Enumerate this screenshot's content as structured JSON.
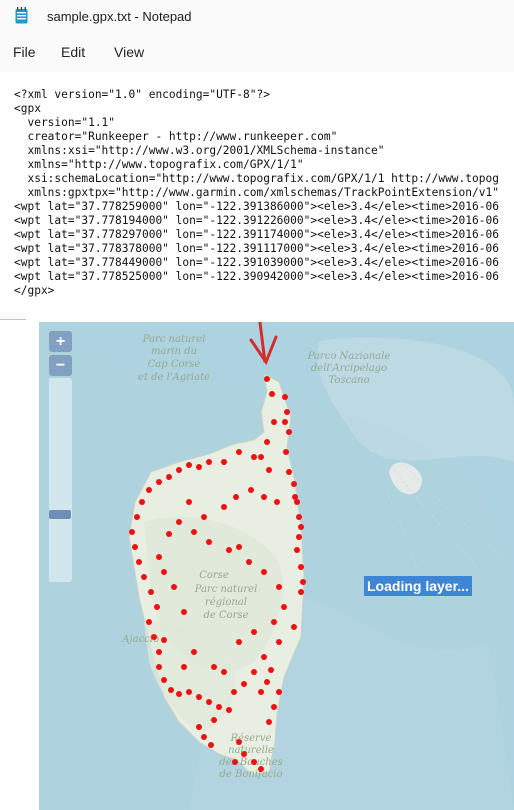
{
  "window": {
    "title": "sample.gpx.txt - Notepad",
    "icon": "notepad-icon"
  },
  "menu": [
    {
      "label": "File"
    },
    {
      "label": "Edit"
    },
    {
      "label": "View"
    }
  ],
  "editor": {
    "lines": [
      "<?xml version=\"1.0\" encoding=\"UTF-8\"?>",
      "<gpx",
      "  version=\"1.1\"",
      "  creator=\"Runkeeper - http://www.runkeeper.com\"",
      "  xmlns:xsi=\"http://www.w3.org/2001/XMLSchema-instance\"",
      "  xmlns=\"http://www.topografix.com/GPX/1/1\"",
      "  xsi:schemaLocation=\"http://www.topografix.com/GPX/1/1 http://www.topog",
      "  xmlns:gpxtpx=\"http://www.garmin.com/xmlschemas/TrackPointExtension/v1\"",
      "<wpt lat=\"37.778259000\" lon=\"-122.391386000\"><ele>3.4</ele><time>2016-06",
      "<wpt lat=\"37.778194000\" lon=\"-122.391226000\"><ele>3.4</ele><time>2016-06",
      "<wpt lat=\"37.778297000\" lon=\"-122.391174000\"><ele>3.4</ele><time>2016-06",
      "<wpt lat=\"37.778378000\" lon=\"-122.391117000\"><ele>3.4</ele><time>2016-06",
      "<wpt lat=\"37.778449000\" lon=\"-122.391039000\"><ele>3.4</ele><time>2016-06",
      "<wpt lat=\"37.778525000\" lon=\"-122.390942000\"><ele>3.4</ele><time>2016-06",
      "</gpx>"
    ]
  },
  "map": {
    "labels": {
      "parc_marin": [
        "Parc naturel",
        "marin du",
        "Cap Corse",
        "et de l'Agriate"
      ],
      "parco_nazionale": [
        "Parco Nazionale",
        "dell'Arcipelago",
        "Toscano"
      ],
      "corse": "Corse",
      "parc_regional": [
        "Parc naturel",
        "régional",
        "de Corse"
      ],
      "reserve": [
        "Réserve",
        "naturelle",
        "des Bouches",
        "de Bonifacio"
      ],
      "town_fragment": "Ajaccio"
    },
    "zoom_in_label": "+",
    "zoom_out_label": "−",
    "loading_text": "Loading layer...",
    "marker_color": "#ee1111",
    "arrow_color": "#d32d2d"
  }
}
